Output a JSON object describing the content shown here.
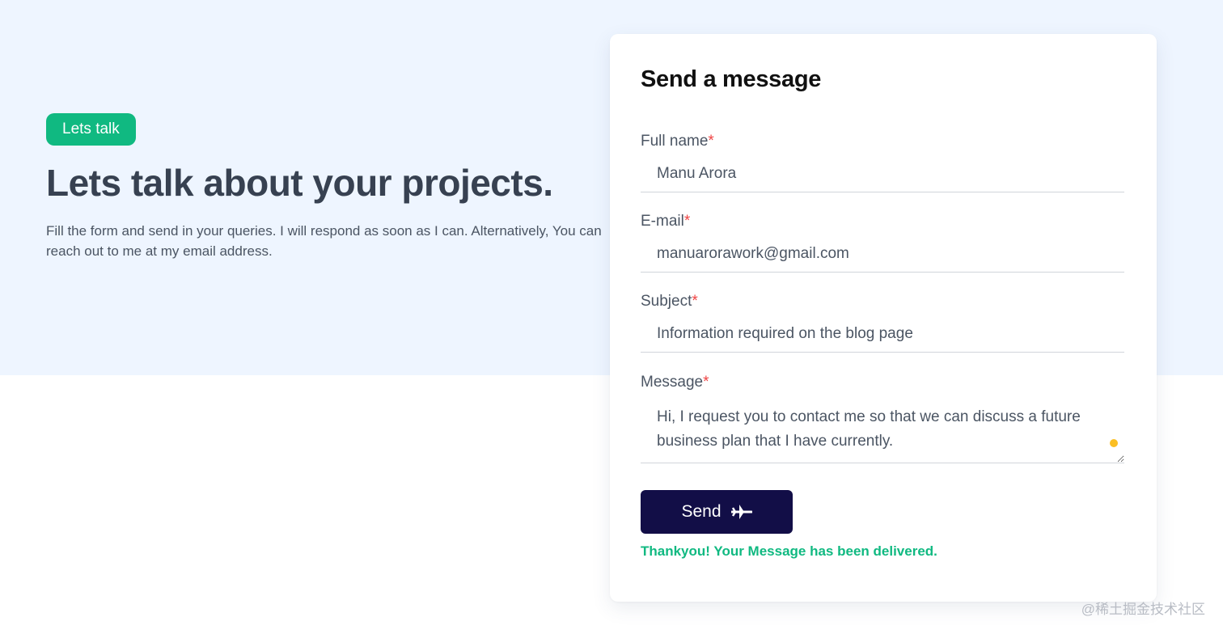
{
  "hero": {
    "badge": "Lets talk",
    "title": "Lets talk about your projects.",
    "description": "Fill the form and send in your queries. I will respond as soon as I can. Alternatively, You can reach out to me at my email address."
  },
  "form": {
    "title": "Send a message",
    "required_marker": "*",
    "fields": {
      "full_name": {
        "label": "Full name",
        "value": "Manu Arora"
      },
      "email": {
        "label": "E-mail",
        "value": "manuarorawork@gmail.com"
      },
      "subject": {
        "label": "Subject",
        "value": "Information required on the blog page"
      },
      "message": {
        "label": "Message",
        "value": "Hi, I request you to contact me so that we can discuss a future business plan that I have currently."
      }
    },
    "send_label": "Send",
    "send_icon": "airplane-icon",
    "success_message": "Thankyou! Your Message has been delivered."
  },
  "watermark": "@稀土掘金技术社区",
  "colors": {
    "accent_green": "#10b981",
    "button_navy": "#120e47",
    "hero_background": "#eef5ff",
    "required_red": "#ef4444"
  }
}
